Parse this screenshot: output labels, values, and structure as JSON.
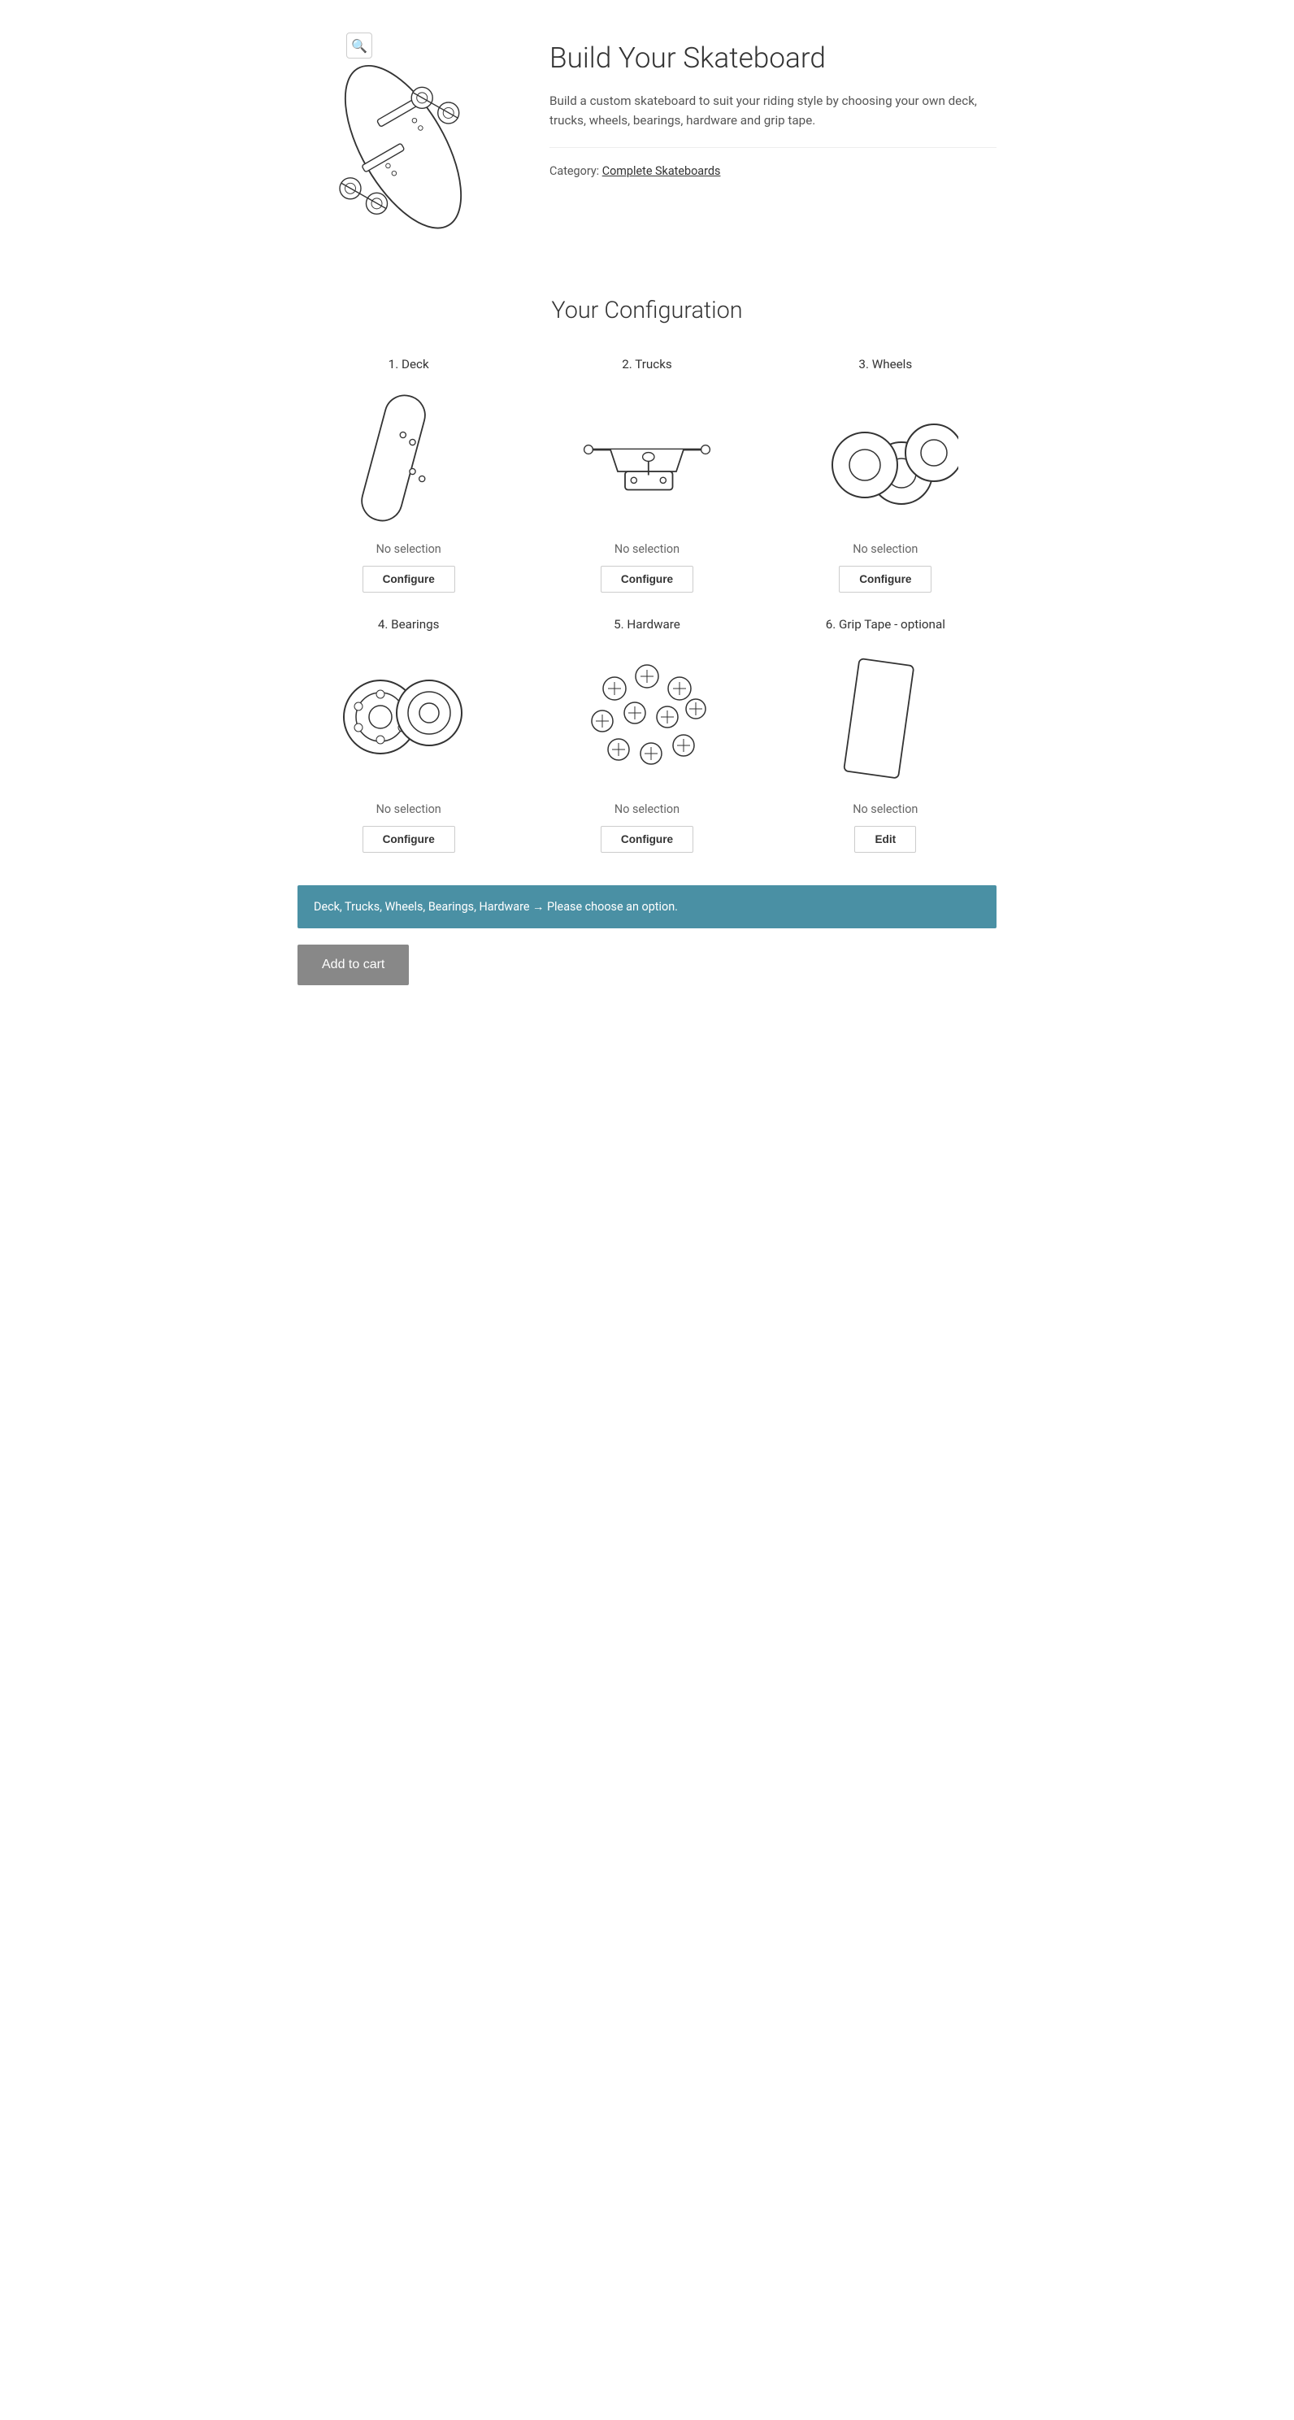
{
  "product": {
    "title": "Build Your Skateboard",
    "description": "Build a custom skateboard to suit your riding style by choosing your own deck, trucks, wheels, bearings, hardware and grip tape.",
    "category_label": "Category:",
    "category_name": "Complete Skateboards",
    "zoom_icon": "🔍"
  },
  "configuration": {
    "section_title": "Your Configuration",
    "items": [
      {
        "id": "deck",
        "label": "1. Deck",
        "status": "No selection",
        "button_label": "Configure"
      },
      {
        "id": "trucks",
        "label": "2. Trucks",
        "status": "No selection",
        "button_label": "Configure"
      },
      {
        "id": "wheels",
        "label": "3. Wheels",
        "status": "No selection",
        "button_label": "Configure"
      },
      {
        "id": "bearings",
        "label": "4. Bearings",
        "status": "No selection",
        "button_label": "Configure"
      },
      {
        "id": "hardware",
        "label": "5. Hardware",
        "status": "No selection",
        "button_label": "Configure"
      },
      {
        "id": "grip-tape",
        "label": "6. Grip Tape - optional",
        "status": "No selection",
        "button_label": "Edit"
      }
    ]
  },
  "notice": {
    "message": "Deck, Trucks, Wheels, Bearings, Hardware → Please choose an option."
  },
  "cart": {
    "button_label": "Add to cart"
  }
}
